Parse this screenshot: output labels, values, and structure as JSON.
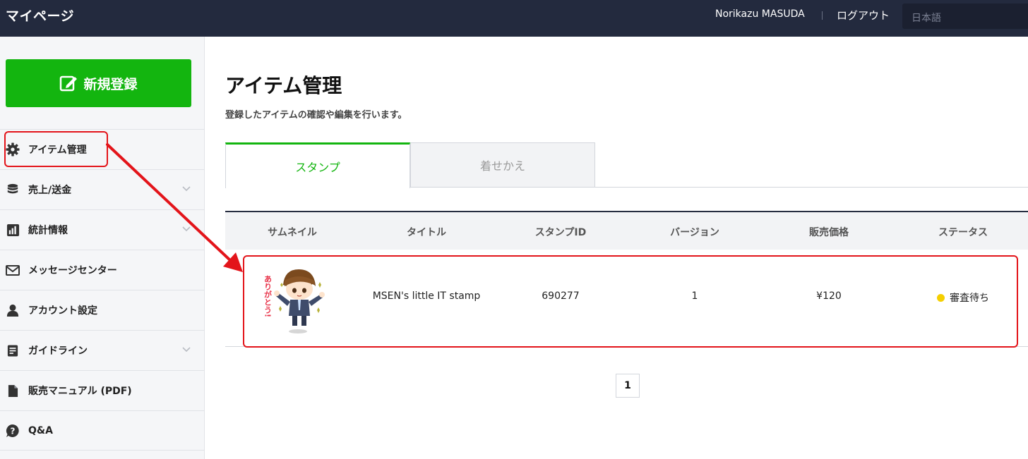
{
  "header": {
    "brand": "マイページ",
    "user_name": "Norikazu MASUDA",
    "logout_label": "ログアウト",
    "language_placeholder": "日本語"
  },
  "sidebar": {
    "new_button_label": "新規登録",
    "items": [
      {
        "label": "アイテム管理",
        "icon": "gear-icon",
        "has_chevron": false
      },
      {
        "label": "売上/送金",
        "icon": "database-icon",
        "has_chevron": true
      },
      {
        "label": "統計情報",
        "icon": "bar-chart-icon",
        "has_chevron": true
      },
      {
        "label": "メッセージセンター",
        "icon": "envelope-icon",
        "has_chevron": false
      },
      {
        "label": "アカウント設定",
        "icon": "user-icon",
        "has_chevron": false
      },
      {
        "label": "ガイドライン",
        "icon": "document-icon",
        "has_chevron": true
      },
      {
        "label": "販売マニュアル (PDF)",
        "icon": "file-icon",
        "has_chevron": false
      },
      {
        "label": "Q&A",
        "icon": "question-icon",
        "has_chevron": false
      }
    ]
  },
  "main": {
    "title": "アイテム管理",
    "description": "登録したアイテムの確認や編集を行います。",
    "tabs": [
      {
        "label": "スタンプ",
        "active": true
      },
      {
        "label": "着せかえ",
        "active": false
      }
    ],
    "table": {
      "columns": [
        "サムネイル",
        "タイトル",
        "スタンプID",
        "バージョン",
        "販売価格",
        "ステータス"
      ],
      "rows": [
        {
          "thumbnail_text": "ありがとう!",
          "title": "MSEN's little IT stamp",
          "stamp_id": "690277",
          "version": "1",
          "price": "¥120",
          "status": "審査待ち"
        }
      ]
    },
    "pagination": {
      "current_page": "1"
    }
  },
  "colors": {
    "header_bg": "#232a3e",
    "accent_green": "#13b50f",
    "annotation_red": "#e3141a",
    "status_pending": "#f5cf00"
  }
}
